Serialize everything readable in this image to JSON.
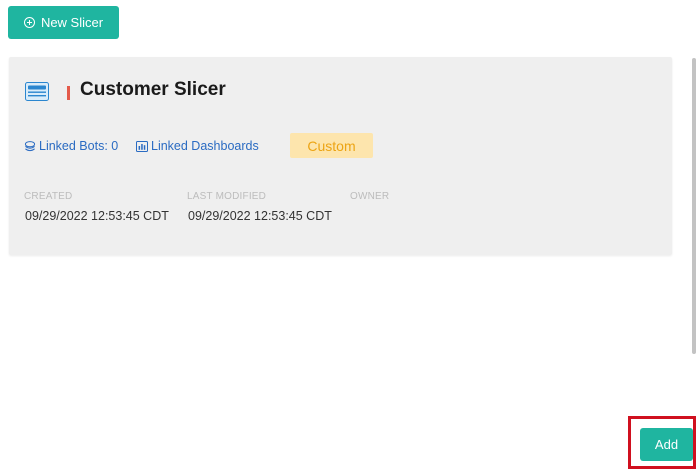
{
  "toolbar": {
    "new_slicer_label": "New Slicer"
  },
  "card": {
    "title": "Customer Slicer",
    "icon": "slicer-icon",
    "linked_bots_label": "Linked Bots: 0",
    "linked_dashboards_label": "Linked Dashboards",
    "badge": "Custom",
    "meta": {
      "created_label": "CREATED",
      "created_value": "09/29/2022 12:53:45 CDT",
      "modified_label": "LAST MODIFIED",
      "modified_value": "09/29/2022 12:53:45 CDT",
      "owner_label": "OWNER",
      "owner_value": ""
    }
  },
  "footer": {
    "add_label": "Add"
  },
  "colors": {
    "primary": "#1fb5a0",
    "accent_bar": "#e45a4a",
    "link": "#2a6bc2",
    "badge_bg": "#fde5ad",
    "badge_text": "#eca414",
    "highlight": "#d0101f"
  }
}
